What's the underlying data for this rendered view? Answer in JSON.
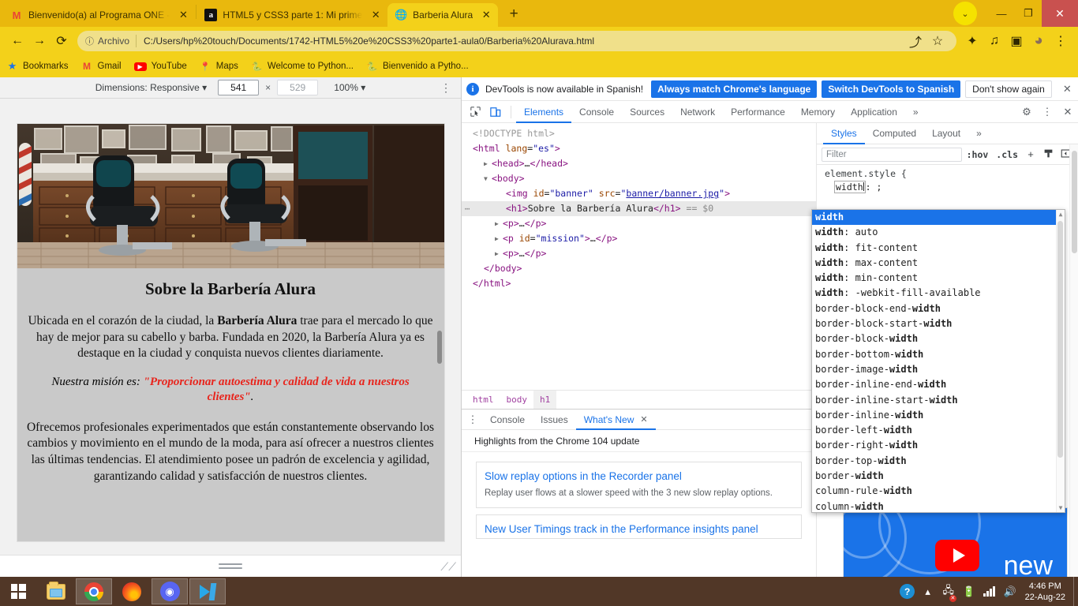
{
  "browser": {
    "tabs": [
      {
        "title": "Bienvenido(a) al Programa ONE -",
        "favicon": "gmail-icon",
        "active": false
      },
      {
        "title": "HTML5 y CSS3 parte 1: Mi prime",
        "favicon": "alura-icon",
        "active": false
      },
      {
        "title": "Barberia Alura",
        "favicon": "globe-icon",
        "active": true
      }
    ],
    "new_tab_label": "+",
    "window_controls": {
      "chevron": "⌄",
      "minimize": "—",
      "maximize": "❐",
      "close": "✕"
    },
    "nav": {
      "back": "←",
      "forward": "→",
      "reload": "⟳",
      "info_icon": "ⓘ",
      "scheme_label": "Archivo",
      "url": "C:/Users/hp%20touch/Documents/1742-HTML5%20e%20CSS3%20parte1-aula0/Barberia%20Alurava.html",
      "share_icon": "⤴",
      "bookmark_icon": "☆",
      "extensions_icon": "✦",
      "media_icon": "♫",
      "sidepanel_icon": "▣",
      "avatar_icon": "●",
      "menu_icon": "⋮"
    },
    "bookmarks": [
      {
        "label": "Bookmarks",
        "icon": "star-icon"
      },
      {
        "label": "Gmail",
        "icon": "gmail-icon"
      },
      {
        "label": "YouTube",
        "icon": "youtube-icon"
      },
      {
        "label": "Maps",
        "icon": "maps-pin-icon"
      },
      {
        "label": "Welcome to Python...",
        "icon": "python-icon"
      },
      {
        "label": "Bienvenido a Pytho...",
        "icon": "python-icon"
      }
    ]
  },
  "device_toolbar": {
    "dimensions_label": "Dimensions: Responsive",
    "dimensions_caret": "▾",
    "width_value": "541",
    "x_label": "×",
    "height_value": "529",
    "zoom_value": "100%",
    "zoom_caret": "▾",
    "kebab": "⋮"
  },
  "page": {
    "banner_alt": "banner/banner.jpg",
    "h1": "Sobre la Barbería Alura",
    "p1_a": "Ubicada en el corazón de la ciudad, la ",
    "p1_b": "Barbería Alura",
    "p1_c": " trae para el mercado lo que hay de mejor para su cabello y barba. Fundada en 2020, la Barbería Alura ya es destaque en la ciudad y conquista nuevos clientes diariamente.",
    "mission_lead": "Nuestra misión es: ",
    "mission_quote": "\"Proporcionar autoestima y calidad de vida a nuestros clientes\"",
    "mission_end": ".",
    "p3": "Ofrecemos profesionales experimentados que están constantemente observando los cambios y movimiento en el mundo de la moda, para así ofrecer a nuestros clientes las últimas tendencias. El atendimiento posee un padrón de excelencia y agilidad, garantizando calidad y satisfacción de nuestros clientes."
  },
  "devtools": {
    "banner": {
      "icon": "info-icon",
      "text": "DevTools is now available in Spanish!",
      "btn_always": "Always match Chrome's language",
      "btn_switch": "Switch DevTools to Spanish",
      "btn_dismiss": "Don't show again",
      "close": "✕"
    },
    "tabs": [
      {
        "label": "Elements",
        "active": true
      },
      {
        "label": "Console",
        "active": false
      },
      {
        "label": "Sources",
        "active": false
      },
      {
        "label": "Network",
        "active": false
      },
      {
        "label": "Performance",
        "active": false
      },
      {
        "label": "Memory",
        "active": false
      },
      {
        "label": "Application",
        "active": false
      }
    ],
    "tabs_overflow": "»",
    "inspect_icon": "⬚",
    "device_icon": "▯",
    "settings_icon": "⚙",
    "kebab_icon": "⋮",
    "close_icon": "✕",
    "dom": [
      {
        "indent": 0,
        "gutter": "",
        "arrow": "",
        "html": "<span class='cm'>&lt;!DOCTYPE html&gt;</span>"
      },
      {
        "indent": 0,
        "gutter": "",
        "arrow": "",
        "html": "<span class='tw'>&lt;html</span> <span class='at'>lang</span>=<span class='av'>\"es\"</span><span class='tw'>&gt;</span>"
      },
      {
        "indent": 1,
        "gutter": "",
        "arrow": "▶",
        "html": "<span class='tw'>&lt;head&gt;</span><span class='tx'>…</span><span class='tw'>&lt;/head&gt;</span>"
      },
      {
        "indent": 1,
        "gutter": "",
        "arrow": "▼",
        "html": "<span class='tw'>&lt;body&gt;</span>"
      },
      {
        "indent": 3,
        "gutter": "",
        "arrow": "",
        "html": "<span class='tw'>&lt;img</span> <span class='at'>id</span>=<span class='av'>\"banner\"</span> <span class='at'>src</span>=<span class='av'>\"</span><span class='lk'>banner/banner.jpg</span><span class='av'>\"</span><span class='tw'>&gt;</span>"
      },
      {
        "indent": 3,
        "gutter": "⋯",
        "arrow": "",
        "selected": true,
        "html": "<span class='tw'>&lt;h1&gt;</span><span class='tx'>Sobre la Barbería Alura</span><span class='tw'>&lt;/h1&gt;</span> <span class='sel0'>== $0</span>"
      },
      {
        "indent": 2,
        "gutter": "",
        "arrow": "▶",
        "html": "<span class='tw'>&lt;p&gt;</span><span class='tx'>…</span><span class='tw'>&lt;/p&gt;</span>"
      },
      {
        "indent": 2,
        "gutter": "",
        "arrow": "▶",
        "html": "<span class='tw'>&lt;p</span> <span class='at'>id</span>=<span class='av'>\"mission\"</span><span class='tw'>&gt;</span><span class='tx'>…</span><span class='tw'>&lt;/p&gt;</span>"
      },
      {
        "indent": 2,
        "gutter": "",
        "arrow": "▶",
        "html": "<span class='tw'>&lt;p&gt;</span><span class='tx'>…</span><span class='tw'>&lt;/p&gt;</span>"
      },
      {
        "indent": 1,
        "gutter": "",
        "arrow": "",
        "html": "<span class='tw'>&lt;/body&gt;</span>"
      },
      {
        "indent": 0,
        "gutter": "",
        "arrow": "",
        "html": "<span class='tw'>&lt;/html&gt;</span>"
      }
    ],
    "breadcrumb": [
      {
        "label": "html",
        "active": false
      },
      {
        "label": "body",
        "active": false
      },
      {
        "label": "h1",
        "active": true
      }
    ],
    "drawer": {
      "kebab": "⋮",
      "tabs": [
        {
          "label": "Console",
          "active": false,
          "closable": false
        },
        {
          "label": "Issues",
          "active": false,
          "closable": false
        },
        {
          "label": "What's New",
          "active": true,
          "closable": true
        }
      ],
      "close_glyph": "✕",
      "subtitle": "Highlights from the Chrome 104 update",
      "cards": [
        {
          "title": "Slow replay options in the Recorder panel",
          "desc": "Replay user flows at a slower speed with the 3 new slow replay options."
        },
        {
          "title": "New User Timings track in the Performance insights panel",
          "desc": ""
        }
      ]
    },
    "styles": {
      "tabs": [
        {
          "label": "Styles",
          "active": true
        },
        {
          "label": "Computed",
          "active": false
        },
        {
          "label": "Layout",
          "active": false
        }
      ],
      "tabs_overflow": "»",
      "filter_placeholder": "Filter",
      "hov_label": ":hov",
      "cls_label": ".cls",
      "plus_icon": "+",
      "pen_icon": "⬛",
      "sidebar_icon": "◀",
      "rule_selector": "element.style {",
      "declaration_text": "width",
      "declaration_suffix": ": ;"
    },
    "autocomplete": {
      "items": [
        {
          "text": "width",
          "selected": true
        },
        {
          "text": "width: auto",
          "selected": false
        },
        {
          "text": "width: fit-content",
          "selected": false
        },
        {
          "text": "width: max-content",
          "selected": false
        },
        {
          "text": "width: min-content",
          "selected": false
        },
        {
          "text": "width: -webkit-fill-available",
          "selected": false
        },
        {
          "text": "border-block-end-width",
          "selected": false
        },
        {
          "text": "border-block-start-width",
          "selected": false
        },
        {
          "text": "border-block-width",
          "selected": false
        },
        {
          "text": "border-bottom-width",
          "selected": false
        },
        {
          "text": "border-image-width",
          "selected": false
        },
        {
          "text": "border-inline-end-width",
          "selected": false
        },
        {
          "text": "border-inline-start-width",
          "selected": false
        },
        {
          "text": "border-inline-width",
          "selected": false
        },
        {
          "text": "border-left-width",
          "selected": false
        },
        {
          "text": "border-right-width",
          "selected": false
        },
        {
          "text": "border-top-width",
          "selected": false
        },
        {
          "text": "border-width",
          "selected": false
        },
        {
          "text": "column-rule-width",
          "selected": false
        },
        {
          "text": "column-width",
          "selected": false
        }
      ],
      "scroll_up": "▲",
      "scroll_down": "▼"
    },
    "promo": {
      "text": "new",
      "icon": "youtube-play-icon"
    }
  },
  "taskbar": {
    "start_label": "start-button",
    "items": [
      {
        "name": "file-explorer",
        "open": false
      },
      {
        "name": "google-chrome",
        "open": true
      },
      {
        "name": "firefox",
        "open": false
      },
      {
        "name": "discord",
        "open": true
      },
      {
        "name": "visual-studio-code",
        "open": true
      }
    ],
    "tray": {
      "help": "?",
      "chevron": "▴",
      "network_error": "✕",
      "battery": "▮",
      "signal": "signal-bars-icon",
      "volume": "🔊",
      "time": "4:46 PM",
      "date": "22-Aug-22"
    }
  },
  "colors": {
    "brand_yellow": "#f3d11a",
    "accent_blue": "#1a73e8",
    "mission_red": "#e8241c",
    "close_red": "#c9514f"
  }
}
